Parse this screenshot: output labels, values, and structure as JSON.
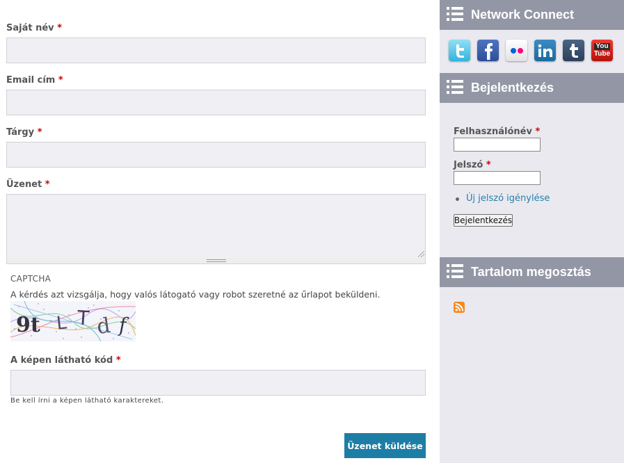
{
  "form": {
    "name_label": "Saját név",
    "email_label": "Email cím",
    "subject_label": "Tárgy",
    "message_label": "Üzenet",
    "required_mark": "*",
    "captcha": {
      "legend": "CAPTCHA",
      "description": "A kérdés azt vizsgálja, hogy valós látogató vagy robot szeretné az űrlapot beküldeni.",
      "image_text": "9tLTdf",
      "code_label": "A képen látható kód",
      "help": "Be kell írni a képen látható karaktereket."
    },
    "submit_label": "Üzenet küldése"
  },
  "sidebar": {
    "network_connect": {
      "title": "Network Connect",
      "icons": [
        "twitter-icon",
        "facebook-icon",
        "flickr-icon",
        "linkedin-icon",
        "tumblr-icon",
        "youtube-icon"
      ],
      "youtube_text_1": "You",
      "youtube_text_2": "Tube"
    },
    "login": {
      "title": "Bejelentkezés",
      "username_label": "Felhasználónév",
      "password_label": "Jelszó",
      "new_password_link": "Új jelszó igénylése",
      "login_button": "Bejelentkezés"
    },
    "share": {
      "title": "Tartalom megosztás",
      "icon": "rss-icon"
    }
  },
  "colors": {
    "accent": "#1d7ea5",
    "sidebar_header": "#9397a5",
    "sidebar_bg": "#e9e9ef",
    "required": "#cc0000",
    "link": "#2a7fa8"
  }
}
